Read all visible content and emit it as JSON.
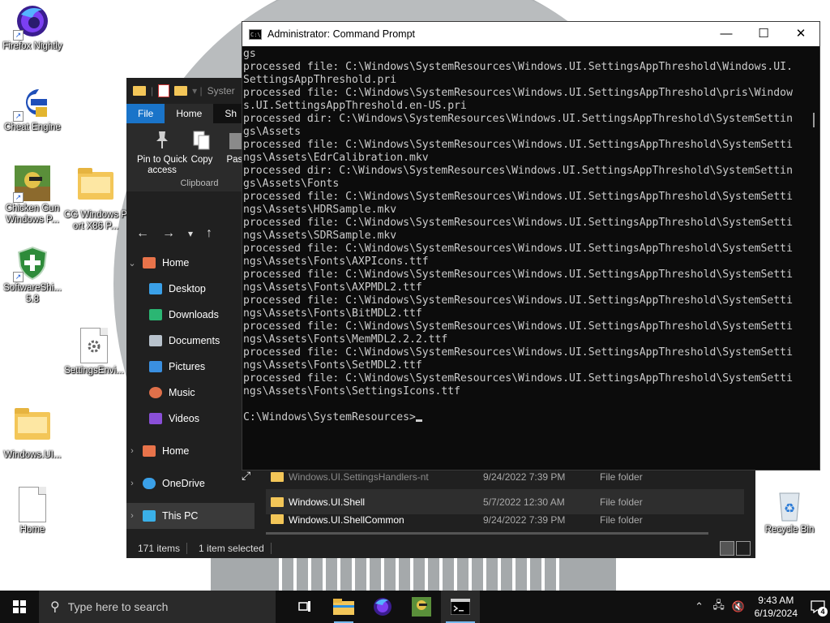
{
  "desktop": {
    "icons": [
      {
        "label": "Firefox Nightly"
      },
      {
        "label": "Cheat Engine"
      },
      {
        "label": "Chicken Gun Windows P..."
      },
      {
        "label": "CG Windows Port X86 P..."
      },
      {
        "label": "SoftwareShi... 5.8"
      },
      {
        "label": "SettingsEnvi..."
      },
      {
        "label": "Windows.UI..."
      },
      {
        "label": "Home"
      },
      {
        "label": "Recycle Bin"
      }
    ]
  },
  "explorer": {
    "title_partial": "Syster",
    "tabs": {
      "file": "File",
      "home": "Home",
      "share": "Sh"
    },
    "ribbon": {
      "pin": "Pin to Quick access",
      "copy": "Copy",
      "paste": "Past",
      "group": "Clipboard"
    },
    "nav": {
      "home": "Home",
      "desktop": "Desktop",
      "downloads": "Downloads",
      "documents": "Documents",
      "pictures": "Pictures",
      "music": "Music",
      "videos": "Videos",
      "home2": "Home",
      "onedrive": "OneDrive",
      "thispc": "This PC"
    },
    "files": [
      {
        "name": "Windows.UI.SettingsHandlers-nt",
        "date": "9/24/2022 7:39 PM",
        "type": "File folder"
      },
      {
        "name": "Windows.UI.Shell",
        "date": "5/7/2022 12:30 AM",
        "type": "File folder"
      },
      {
        "name": "Windows.UI.ShellCommon",
        "date": "9/24/2022 7:39 PM",
        "type": "File folder"
      }
    ],
    "status": {
      "items": "171 items",
      "selected": "1 item selected"
    }
  },
  "cmd": {
    "title": "Administrator: Command Prompt",
    "lines": [
      "gs",
      "processed file: C:\\Windows\\SystemResources\\Windows.UI.SettingsAppThreshold\\Windows.UI.",
      "SettingsAppThreshold.pri",
      "processed file: C:\\Windows\\SystemResources\\Windows.UI.SettingsAppThreshold\\pris\\Window",
      "s.UI.SettingsAppThreshold.en-US.pri",
      "processed dir: C:\\Windows\\SystemResources\\Windows.UI.SettingsAppThreshold\\SystemSettin",
      "gs\\Assets",
      "processed file: C:\\Windows\\SystemResources\\Windows.UI.SettingsAppThreshold\\SystemSetti",
      "ngs\\Assets\\EdrCalibration.mkv",
      "processed dir: C:\\Windows\\SystemResources\\Windows.UI.SettingsAppThreshold\\SystemSettin",
      "gs\\Assets\\Fonts",
      "processed file: C:\\Windows\\SystemResources\\Windows.UI.SettingsAppThreshold\\SystemSetti",
      "ngs\\Assets\\HDRSample.mkv",
      "processed file: C:\\Windows\\SystemResources\\Windows.UI.SettingsAppThreshold\\SystemSetti",
      "ngs\\Assets\\SDRSample.mkv",
      "processed file: C:\\Windows\\SystemResources\\Windows.UI.SettingsAppThreshold\\SystemSetti",
      "ngs\\Assets\\Fonts\\AXPIcons.ttf",
      "processed file: C:\\Windows\\SystemResources\\Windows.UI.SettingsAppThreshold\\SystemSetti",
      "ngs\\Assets\\Fonts\\AXPMDL2.ttf",
      "processed file: C:\\Windows\\SystemResources\\Windows.UI.SettingsAppThreshold\\SystemSetti",
      "ngs\\Assets\\Fonts\\BitMDL2.ttf",
      "processed file: C:\\Windows\\SystemResources\\Windows.UI.SettingsAppThreshold\\SystemSetti",
      "ngs\\Assets\\Fonts\\MemMDL2.2.2.ttf",
      "processed file: C:\\Windows\\SystemResources\\Windows.UI.SettingsAppThreshold\\SystemSetti",
      "ngs\\Assets\\Fonts\\SetMDL2.ttf",
      "processed file: C:\\Windows\\SystemResources\\Windows.UI.SettingsAppThreshold\\SystemSetti",
      "ngs\\Assets\\Fonts\\SettingsIcons.ttf",
      ""
    ],
    "prompt": "C:\\Windows\\SystemResources>"
  },
  "taskbar": {
    "search_placeholder": "Type here to search",
    "time": "9:43 AM",
    "date": "6/19/2024",
    "notification_count": "4"
  },
  "icons": [
    "firefox-icon",
    "cheat-engine-icon",
    "chicken-gun-icon",
    "folder-icon",
    "softwareshield-icon",
    "settings-file-icon",
    "file-icon",
    "recycle-bin-icon",
    "windows-logo-icon",
    "search-icon",
    "task-view-icon",
    "file-explorer-icon",
    "firefox-nightly-icon",
    "terminal-icon",
    "chevron-up-icon",
    "network-icon",
    "volume-muted-icon",
    "notification-icon"
  ],
  "colors": {
    "accent": "#1a74c9",
    "taskbar": "#101010",
    "cmd_bg": "#0c0c0c",
    "explorer_bg": "#202020",
    "highlight": "#76b9ed"
  }
}
